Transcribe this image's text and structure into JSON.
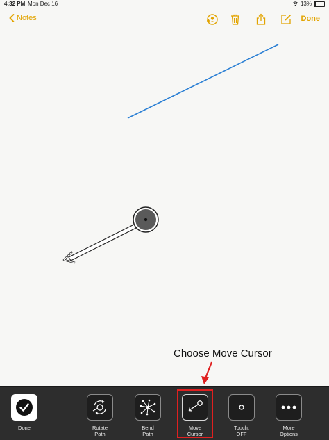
{
  "status": {
    "time": "4:32 PM",
    "date": "Mon Dec 16",
    "battery": "13%",
    "battery_level": 0.13
  },
  "nav": {
    "back_label": "Notes",
    "done_label": "Done"
  },
  "annotation": {
    "text": "Choose Move Cursor"
  },
  "toolbar": {
    "items": [
      {
        "label_1": "Done",
        "label_2": ""
      },
      {
        "label_1": "Rotate",
        "label_2": "Path"
      },
      {
        "label_1": "Bend",
        "label_2": "Path"
      },
      {
        "label_1": "Move",
        "label_2": "Cursor"
      },
      {
        "label_1": "Touch:",
        "label_2": "OFF"
      },
      {
        "label_1": "More",
        "label_2": "Options"
      }
    ],
    "highlighted_index": 3
  },
  "colors": {
    "accent": "#e2a400",
    "line": "#2a7fd4",
    "highlight": "#e02020",
    "toolbar_bg": "#2d2d2d"
  }
}
